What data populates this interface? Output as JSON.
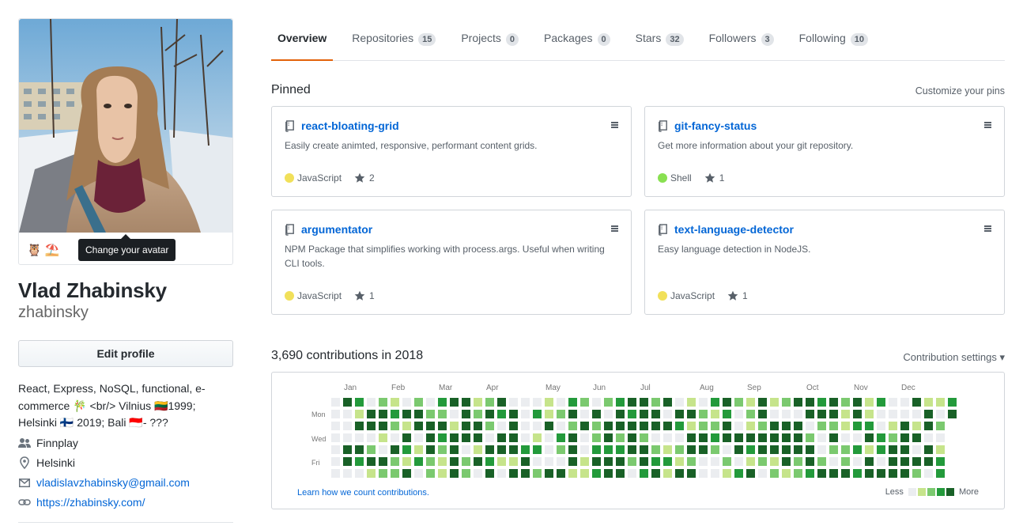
{
  "profile": {
    "avatar_alt": "Profile photo",
    "emojis": [
      "🦉",
      "⛱️"
    ],
    "tooltip": "Change your avatar",
    "full_name": "Vlad Zhabinsky",
    "username": "zhabinsky",
    "edit_button": "Edit profile",
    "bio_line1": "React, Express, NoSQL, functional, e-",
    "bio_line2": "commerce 🎋 <br/> Vilnius 🇱🇹1999;",
    "bio_line3": "Helsinki 🇫🇮 2019; Bali 🇮🇩- ???",
    "company": "Finnplay",
    "location": "Helsinki",
    "email": "vladislavzhabinsky@gmail.com",
    "website": "https://zhabinsky.com/"
  },
  "tabs": [
    {
      "label": "Overview",
      "count": ""
    },
    {
      "label": "Repositories",
      "count": "15"
    },
    {
      "label": "Projects",
      "count": "0"
    },
    {
      "label": "Packages",
      "count": "0"
    },
    {
      "label": "Stars",
      "count": "32"
    },
    {
      "label": "Followers",
      "count": "3"
    },
    {
      "label": "Following",
      "count": "10"
    }
  ],
  "pinned": {
    "title": "Pinned",
    "customize": "Customize your pins",
    "cards": [
      {
        "name": "react-bloating-grid",
        "desc": "Easily create animted, responsive, performant content grids.",
        "lang": "JavaScript",
        "lang_color": "#f1e05a",
        "stars": "2"
      },
      {
        "name": "git-fancy-status",
        "desc": "Get more information about your git repository.",
        "lang": "Shell",
        "lang_color": "#89e051",
        "stars": "1"
      },
      {
        "name": "argumentator",
        "desc": "NPM Package that simplifies working with process.args. Useful when writing CLI tools.",
        "lang": "JavaScript",
        "lang_color": "#f1e05a",
        "stars": "1"
      },
      {
        "name": "text-language-detector",
        "desc": "Easy language detection in NodeJS.",
        "lang": "JavaScript",
        "lang_color": "#f1e05a",
        "stars": "1"
      }
    ]
  },
  "contributions": {
    "title": "3,690 contributions in 2018",
    "settings": "Contribution settings ▾",
    "months": [
      "Jan",
      "Feb",
      "Mar",
      "Apr",
      "May",
      "Jun",
      "Jul",
      "Aug",
      "Sep",
      "Oct",
      "Nov",
      "Dec"
    ],
    "days": [
      "Mon",
      "Wed",
      "Fri"
    ],
    "learn": "Learn how we count contributions.",
    "less": "Less",
    "more": "More",
    "colors": [
      "#ebedf0",
      "#c6e48b",
      "#7bc96f",
      "#239a3b",
      "#196127"
    ]
  }
}
